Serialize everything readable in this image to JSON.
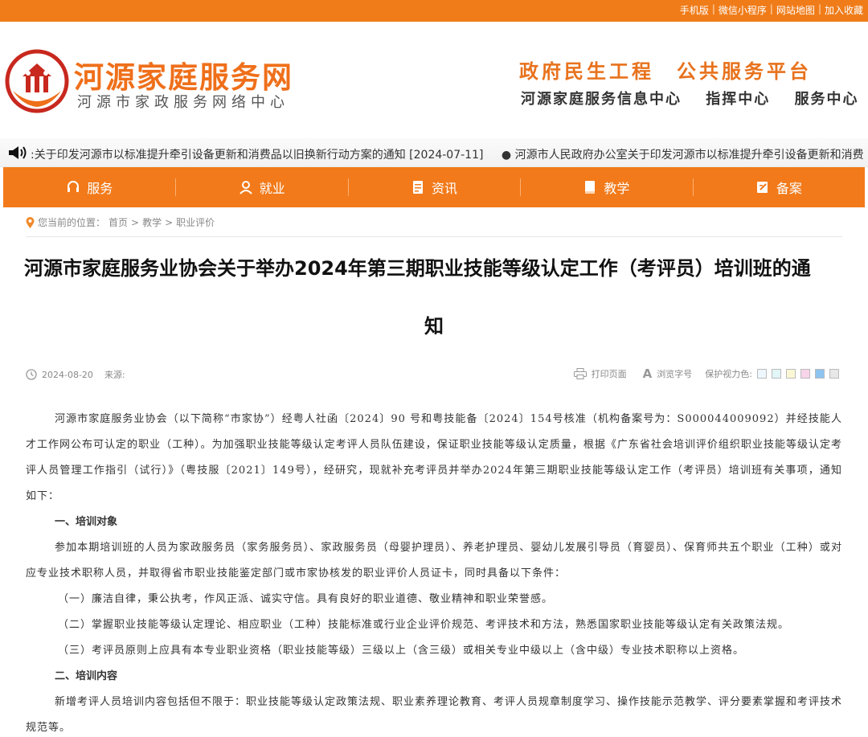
{
  "topbar": {
    "links": [
      "手机版",
      "微信小程序",
      "网站地图",
      "加入收藏"
    ],
    "separator": "|"
  },
  "header": {
    "site_title": "河源家庭服务网",
    "site_subtitle": "河源市家政服务网络中心",
    "slogan_main": "政府民生工程　公共服务平台",
    "slogan_items": [
      "河源家庭服务信息中心",
      "指挥中心",
      "服务中心"
    ]
  },
  "ticker": {
    "items": [
      ":关于印发河源市以标准提升牵引设备更新和消费品以旧换新行动方案的通知 [2024-07-11]",
      "● 河源市人民政府办公室关于印发河源市以标准提升牵引设备更新和消费"
    ]
  },
  "nav": {
    "items": [
      {
        "label": "服务",
        "icon": "headset-icon"
      },
      {
        "label": "就业",
        "icon": "user-icon"
      },
      {
        "label": "资讯",
        "icon": "document-icon"
      },
      {
        "label": "教学",
        "icon": "book-icon"
      },
      {
        "label": "备案",
        "icon": "edit-icon"
      }
    ]
  },
  "breadcrumb": {
    "prefix": "您当前的位置：",
    "home": "首页",
    "sep1": ">",
    "level1": "教学",
    "sep2": ">",
    "level2": "职业评价"
  },
  "article": {
    "title_line1": "河源市家庭服务业协会关于举办2024年第三期职业技能等级认定工作（考评员）培训班的通",
    "title_line2": "知",
    "date": "2024-08-20",
    "source_label": "来源:",
    "print_label": "打印页面",
    "font_label": "浏览字号",
    "eye_label": "保护视力色:",
    "eye_colors": [
      "#eef7ff",
      "#e2f5f7",
      "#fbf7d6",
      "#f7d4ea",
      "#8ec4f0",
      "#e8e8e8"
    ],
    "paragraphs": [
      {
        "type": "p",
        "text": "河源市家庭服务业协会（以下简称“市家协”）经粤人社函〔2024〕90 号和粤技能备〔2024〕154号核准（机构备案号为：S000044009092）并经技能人才工作网公布可认定的职业（工种）。为加强职业技能等级认定考评人员队伍建设，保证职业技能等级认定质量，根据《广东省社会培训评价组织职业技能等级认定考评人员管理工作指引（试行）》（粤技服〔2021〕149号），经研究，现就补充考评员并举办2024年第三期职业技能等级认定工作（考评员）培训班有关事项，通知如下："
      },
      {
        "type": "h",
        "text": "一、培训对象"
      },
      {
        "type": "p",
        "text": "参加本期培训班的人员为家政服务员（家务服务员）、家政服务员（母婴护理员）、养老护理员、婴幼儿发展引导员（育婴员）、保育师共五个职业（工种）或对应专业技术职称人员，并取得省市职业技能鉴定部门或市家协核发的职业评价人员证卡，同时具备以下条件："
      },
      {
        "type": "sub",
        "text": "（一）廉洁自律，秉公执考，作风正派、诚实守信。具有良好的职业道德、敬业精神和职业荣誉感。"
      },
      {
        "type": "sub",
        "text": "（二）掌握职业技能等级认定理论、相应职业（工种）技能标准或行业企业评价规范、考评技术和方法，熟悉国家职业技能等级认定有关政策法规。"
      },
      {
        "type": "sub",
        "text": "（三）考评员原则上应具有本专业职业资格（职业技能等级）三级以上（含三级）或相关专业中级以上（含中级）专业技术职称以上资格。"
      },
      {
        "type": "h",
        "text": "二、培训内容"
      },
      {
        "type": "p",
        "text": "新增考评人员培训内容包括但不限于：职业技能等级认定政策法规、职业素养理论教育、考评人员规章制度学习、操作技能示范教学、评分要素掌握和考评技术规范等。"
      }
    ]
  },
  "colors": {
    "brand_orange": "#f27a1a",
    "title_orange": "#ef6f1a"
  }
}
